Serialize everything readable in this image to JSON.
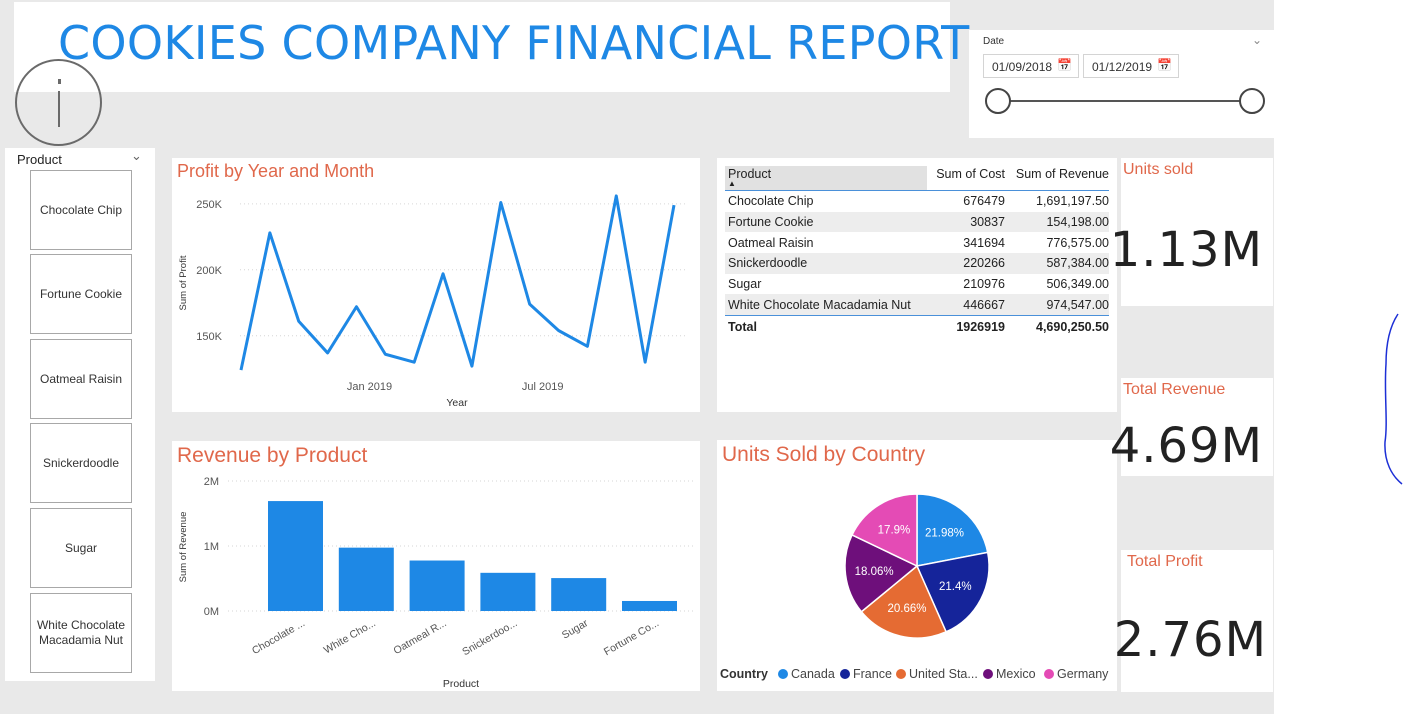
{
  "report": {
    "title": "COOKIES COMPANY FINANCIAL REPORT"
  },
  "date_filter": {
    "label": "Date",
    "start": "01/09/2018",
    "end": "01/12/2019"
  },
  "product_slicer": {
    "header": "Product",
    "items": [
      "Chocolate Chip",
      "Fortune Cookie",
      "Oatmeal Raisin",
      "Snickerdoodle",
      "Sugar",
      "White Chocolate Macadamia Nut"
    ]
  },
  "kpis": {
    "units_sold": {
      "label": "Units sold",
      "value": "1.13M"
    },
    "total_revenue": {
      "label": "Total Revenue",
      "value": "4.69M"
    },
    "total_profit": {
      "label": "Total Profit",
      "value": "2.76M"
    }
  },
  "table": {
    "headers": [
      "Product",
      "Sum of Cost",
      "Sum of Revenue"
    ],
    "rows": [
      [
        "Chocolate Chip",
        "676479",
        "1,691,197.50"
      ],
      [
        "Fortune Cookie",
        "30837",
        "154,198.00"
      ],
      [
        "Oatmeal Raisin",
        "341694",
        "776,575.00"
      ],
      [
        "Snickerdoodle",
        "220266",
        "587,384.00"
      ],
      [
        "Sugar",
        "210976",
        "506,349.00"
      ],
      [
        "White Chocolate Macadamia Nut",
        "446667",
        "974,547.00"
      ]
    ],
    "total": [
      "Total",
      "1926919",
      "4,690,250.50"
    ]
  },
  "chart_data": [
    {
      "type": "line",
      "title": "Profit by Year and Month",
      "xlabel": "Year",
      "ylabel": "Sum of Profit",
      "x_ticks": [
        "Jan 2019",
        "Jul 2019"
      ],
      "y_ticks": [
        "150K",
        "200K",
        "250K"
      ],
      "ylim": [
        118000,
        262000
      ],
      "x": [
        "2018-09",
        "2018-10",
        "2018-11",
        "2018-12",
        "2019-01",
        "2019-02",
        "2019-03",
        "2019-04",
        "2019-05",
        "2019-06",
        "2019-07",
        "2019-08",
        "2019-09",
        "2019-10",
        "2019-11",
        "2019-12"
      ],
      "values": [
        124000,
        228000,
        161000,
        137000,
        172000,
        136000,
        130000,
        197000,
        127000,
        251000,
        174000,
        154000,
        142000,
        256000,
        130000,
        249000
      ],
      "grid": true,
      "color": "#1e88e5"
    },
    {
      "type": "bar",
      "title": "Revenue by Product",
      "xlabel": "Product",
      "ylabel": "Sum of Revenue",
      "categories": [
        "Chocolate ...",
        "White Cho...",
        "Oatmeal R...",
        "Snickerdoo...",
        "Sugar",
        "Fortune Co..."
      ],
      "values": [
        1691197.5,
        974547,
        776575,
        587384,
        506349,
        154198
      ],
      "y_ticks": [
        "0M",
        "1M",
        "2M"
      ],
      "ylim": [
        0,
        2000000
      ],
      "grid": true,
      "color": "#1e88e5"
    },
    {
      "type": "pie",
      "title": "Units Sold by Country",
      "legend_title": "Country",
      "legend_position": "bottom",
      "slices": [
        {
          "name": "Canada",
          "value": 21.98,
          "label": "21.98%",
          "color": "#1e88e5"
        },
        {
          "name": "France",
          "value": 21.4,
          "label": "21.4%",
          "color": "#15249a"
        },
        {
          "name": "United Sta...",
          "value": 20.66,
          "label": "20.66%",
          "color": "#e56b33"
        },
        {
          "name": "Mexico",
          "value": 18.06,
          "label": "18.06%",
          "color": "#6e0f7b"
        },
        {
          "name": "Germany",
          "value": 17.9,
          "label": "17.9%",
          "color": "#e44bb5"
        }
      ]
    }
  ]
}
